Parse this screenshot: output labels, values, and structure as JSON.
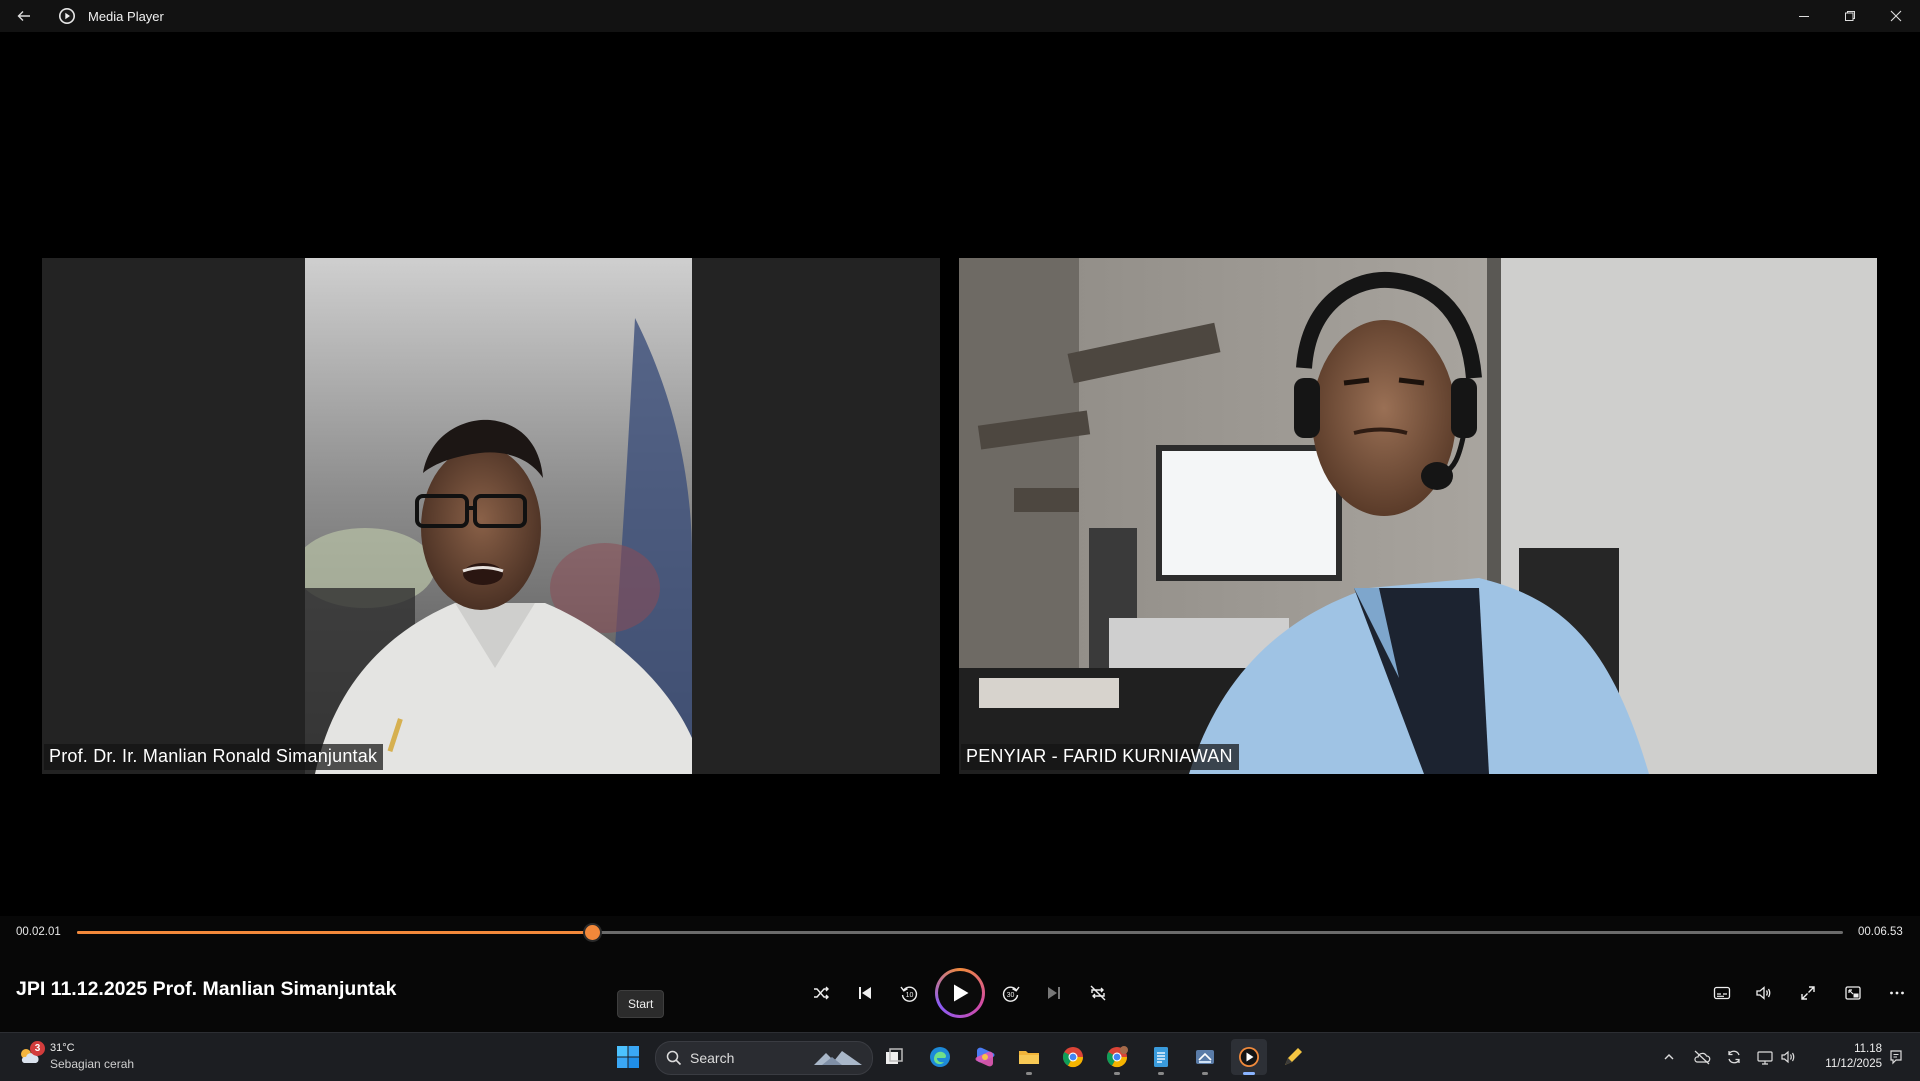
{
  "window": {
    "title": "Media Player",
    "icons": {
      "back": "back-arrow-icon",
      "app": "media-player-icon",
      "minimize": "minimize-icon",
      "restore": "restore-icon",
      "close": "close-icon"
    }
  },
  "video": {
    "participants": [
      {
        "name": "Prof. Dr. Ir. Manlian Ronald Simanjuntak"
      },
      {
        "name": "PENYIAR - FARID KURNIAWAN"
      }
    ]
  },
  "playback": {
    "current_time": "00.02.01",
    "total_time": "00.06.53",
    "progress": 0.2915,
    "accent_color": "#f2883a"
  },
  "media": {
    "title": "JPI 11.12.2025 Prof. Manlian Simanjuntak"
  },
  "controls": {
    "icons": [
      "shuffle-icon",
      "previous-icon",
      "rewind-10-icon",
      "play-icon",
      "forward-30-icon",
      "next-icon",
      "repeat-off-icon",
      "subtitles-icon",
      "volume-icon",
      "fullscreen-icon",
      "mini-player-icon",
      "more-icon"
    ],
    "rewind_label": "10",
    "forward_label": "30",
    "tooltip": "Start"
  },
  "taskbar": {
    "weather": {
      "badge": "3",
      "temperature": "31°C",
      "condition": "Sebagian cerah"
    },
    "search_placeholder": "Search",
    "apps": [
      "start-icon",
      "search-icon",
      "task-view-icon",
      "edge-icon",
      "copilot-icon",
      "file-explorer-icon",
      "chrome-icon",
      "chrome-profile-icon",
      "notepad-icon",
      "app-icon",
      "media-player-icon",
      "pen-tool-icon"
    ],
    "tray": [
      "chevron-up-icon",
      "cloud-off-icon",
      "sync-icon",
      "network-icon",
      "speaker-icon",
      "notification-icon"
    ],
    "clock": {
      "time": "11.18",
      "date": "11/12/2025"
    }
  }
}
